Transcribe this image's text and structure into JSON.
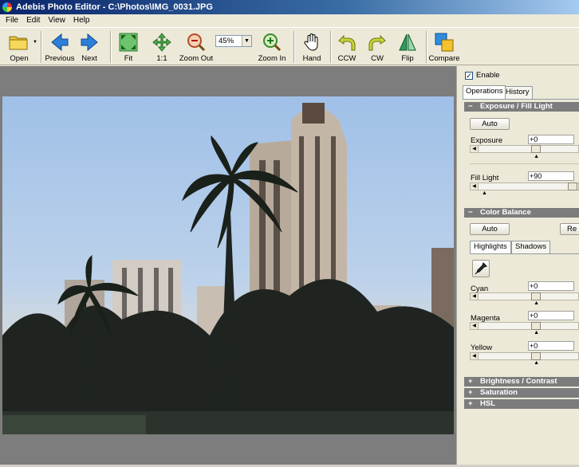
{
  "window": {
    "title": "Adebis Photo Editor - C:\\Photos\\IMG_0031.JPG"
  },
  "menu": [
    "File",
    "Edit",
    "View",
    "Help"
  ],
  "toolbar": {
    "open": "Open",
    "previous": "Previous",
    "next": "Next",
    "fit": "Fit",
    "one_to_one": "1:1",
    "zoom_out": "Zoom Out",
    "zoom_value": "45%",
    "zoom_in": "Zoom In",
    "hand": "Hand",
    "ccw": "CCW",
    "cw": "CW",
    "flip": "Flip",
    "compare": "Compare"
  },
  "panel": {
    "enable_label": "Enable",
    "enable_checked": true,
    "tabs": [
      "Operations",
      "History"
    ],
    "exposure_section": "Exposure / Fill Light",
    "auto": "Auto",
    "exposure_label": "Exposure",
    "exposure_value": "+0",
    "exposure_level": 0.58,
    "fill_light_label": "Fill Light",
    "fill_light_value": "+90",
    "fill_light_level": 0.98,
    "color_balance_section": "Color Balance",
    "reset": "Re",
    "subtabs": [
      "Highlights",
      "Shadows"
    ],
    "cyan_label": "Cyan",
    "cyan_value": "+0",
    "cyan_level": 0.58,
    "magenta_label": "Magenta",
    "magenta_value": "+0",
    "magenta_level": 0.58,
    "yellow_label": "Yellow",
    "yellow_value": "+0",
    "yellow_level": 0.58,
    "brightness_section": "Brightness / Contrast",
    "saturation_section": "Saturation",
    "hsl_section": "HSL",
    "expanded_sign": "−",
    "collapsed_sign": "+"
  },
  "colors": {
    "section_header": "#7c7c7c",
    "canvas_bg": "#7d7d7d",
    "title_bar": "#0a246a"
  }
}
